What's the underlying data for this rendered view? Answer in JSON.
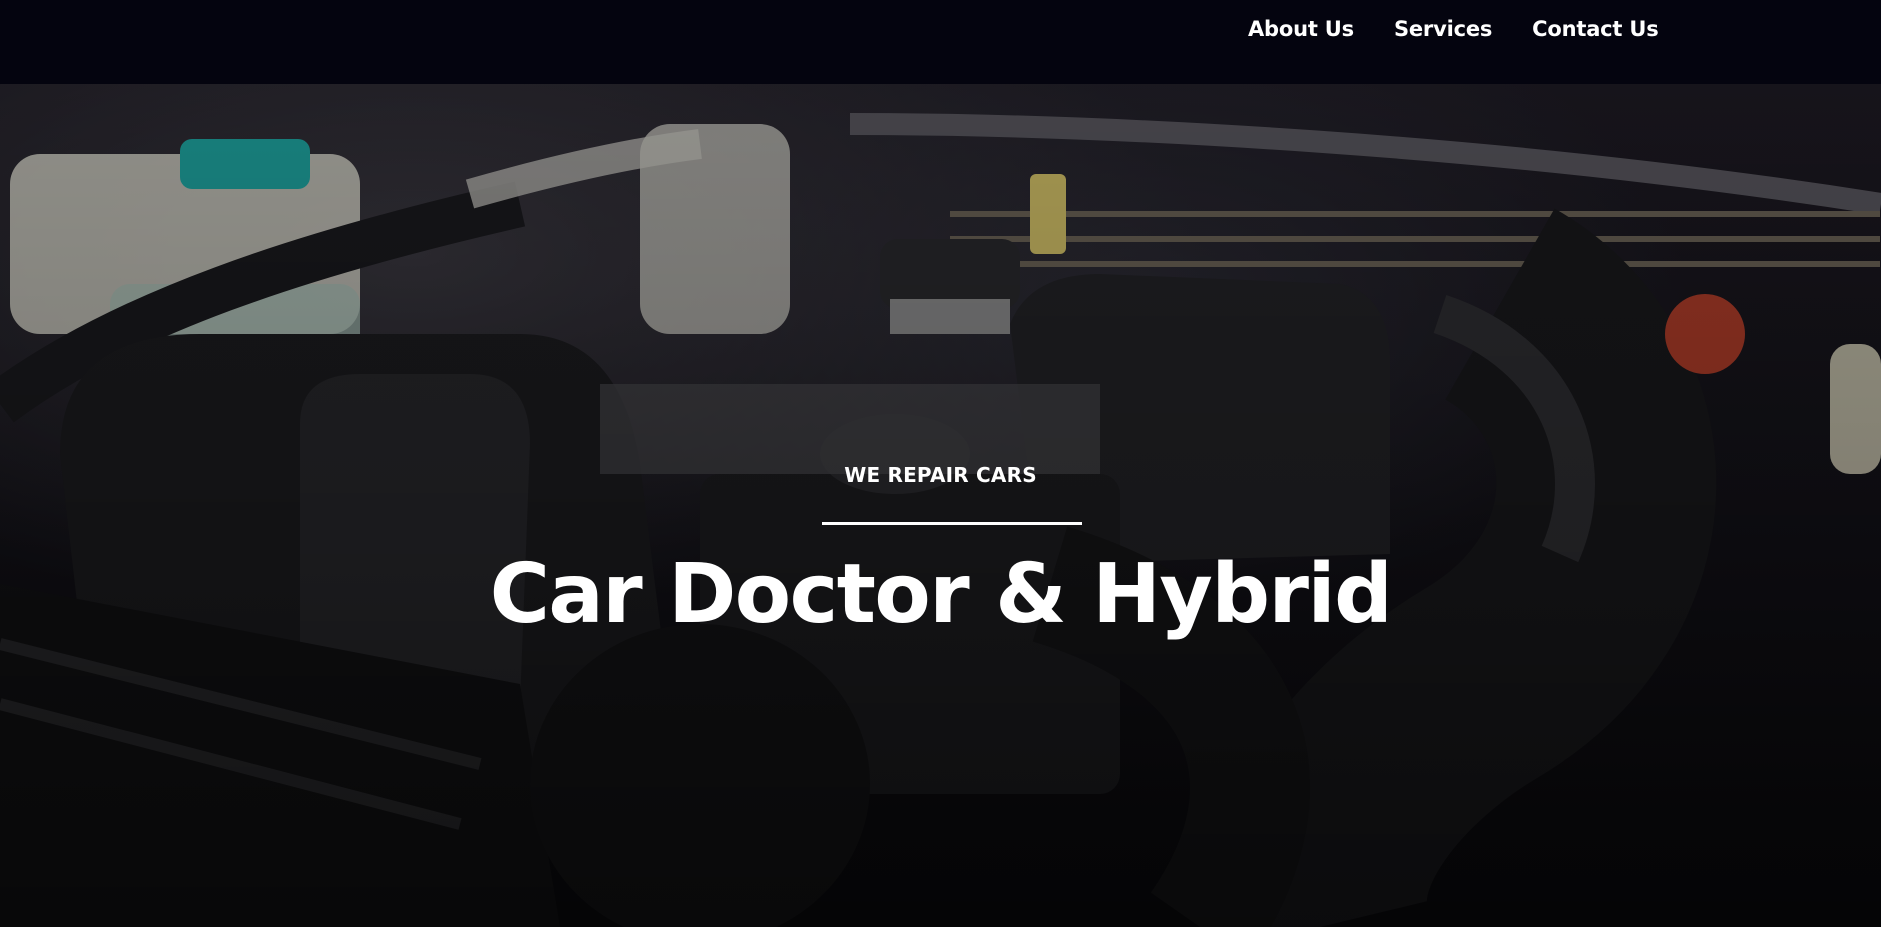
{
  "nav": {
    "items": [
      {
        "label": "About Us"
      },
      {
        "label": "Services"
      },
      {
        "label": "Contact Us"
      }
    ]
  },
  "hero": {
    "kicker": "WE REPAIR CARS",
    "title": "Car Doctor & Hybrid",
    "background": "engine-bay-photo"
  },
  "colors": {
    "topbar": "#04040f",
    "text": "#ffffff"
  }
}
